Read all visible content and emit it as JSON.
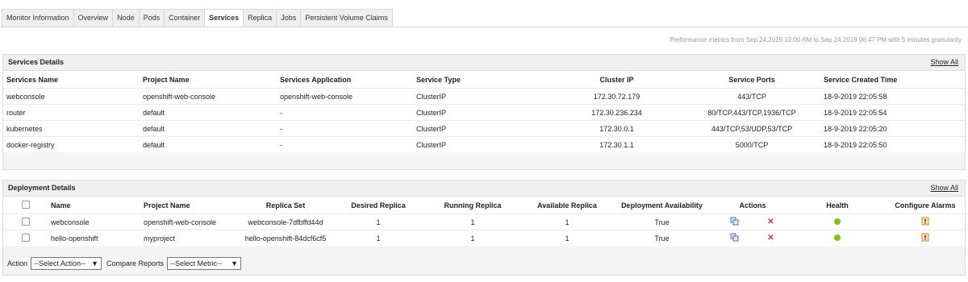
{
  "tabs": [
    "Monitor Information",
    "Overview",
    "Node",
    "Pods",
    "Container",
    "Services",
    "Replica",
    "Jobs",
    "Persistent Volume Claims"
  ],
  "active_tab": "Services",
  "perf_text": "Performance metrics from Sep 24,2019 12:00 AM to Sep 24,2019 06:47 PM with 5 minutes granularity",
  "services": {
    "title": "Services Details",
    "show_all": "Show All",
    "headers": [
      "Services Name",
      "Project Name",
      "Services Application",
      "Service Type",
      "Cluster IP",
      "Service Ports",
      "Service Created Time"
    ],
    "rows": [
      [
        "webconsole",
        "openshift-web-console",
        "openshift-web-console",
        "ClusterIP",
        "172.30.72.179",
        "443/TCP",
        "18-9-2019 22:05:58"
      ],
      [
        "router",
        "default",
        "-",
        "ClusterIP",
        "172.30.236.234",
        "80/TCP,443/TCP,1936/TCP",
        "18-9-2019 22:05:54"
      ],
      [
        "kubernetes",
        "default",
        "-",
        "ClusterIP",
        "172.30.0.1",
        "443/TCP,53/UDP,53/TCP",
        "18-9-2019 22:05:20"
      ],
      [
        "docker-registry",
        "default",
        "-",
        "ClusterIP",
        "172.30.1.1",
        "5000/TCP",
        "18-9-2019 22:05:50"
      ]
    ]
  },
  "deployments": {
    "title": "Deployment Details",
    "show_all": "Show All",
    "headers": [
      "Name",
      "Project Name",
      "Replica Set",
      "Desired Replica",
      "Running Replica",
      "Available Replica",
      "Deployment Availability",
      "Actions",
      "Health",
      "Configure Alarms"
    ],
    "rows": [
      [
        "webconsole",
        "openshift-web-console",
        "webconsole-7dfbffd44d",
        "1",
        "1",
        "1",
        "True"
      ],
      [
        "hello-openshift",
        "myproject",
        "hello-openshift-84dcf6cf5",
        "1",
        "1",
        "1",
        "True"
      ]
    ]
  },
  "action_label": "Action",
  "action_select": "--Select Action--",
  "compare_label": "Compare Reports",
  "compare_select": "--Select Metric--",
  "icons": {
    "health": "green-dot-icon",
    "delete": "red-x-icon",
    "edit": "edit-icon",
    "alarm": "alarm-bell-icon",
    "dropdown": "caret-down-icon"
  },
  "colors": {
    "health": "#7dc21e",
    "delete": "#d92b2b"
  }
}
